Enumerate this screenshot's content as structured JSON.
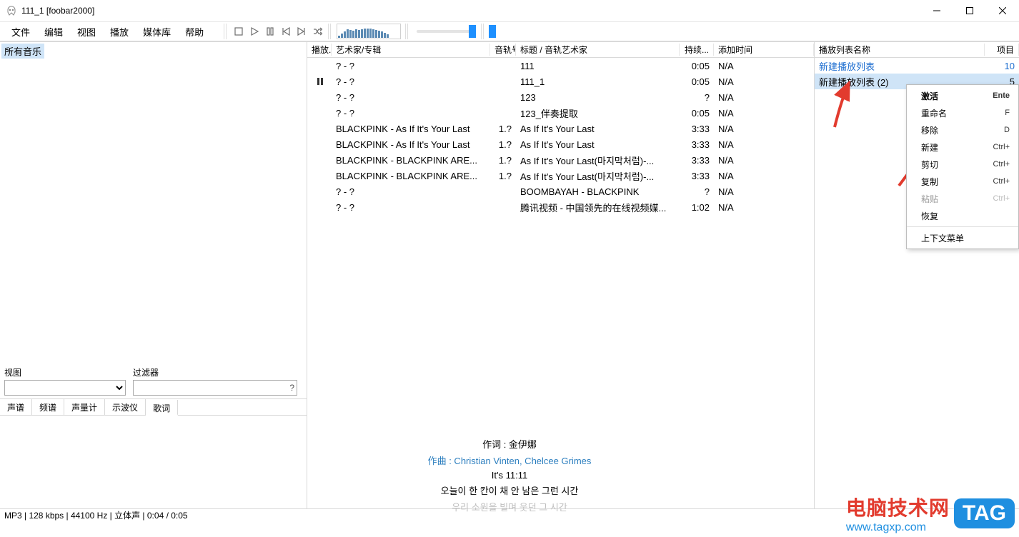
{
  "window": {
    "title": "111_1  [foobar2000]"
  },
  "menu": {
    "items": [
      "文件",
      "编辑",
      "视图",
      "播放",
      "媒体库",
      "帮助"
    ]
  },
  "left": {
    "all_music": "所有音乐",
    "view_label": "视图",
    "filter_label": "过滤器",
    "filter_q": "?"
  },
  "tabs": {
    "items": [
      "声谱",
      "频谱",
      "声量计",
      "示波仪",
      "歌词"
    ],
    "active": 4
  },
  "lyrics": {
    "l1": "作词 : 金伊娜",
    "l2": "作曲 : Christian Vinten, Chelcee Grimes",
    "l3": "It's 11:11",
    "l4": "오늘이 한 칸이 채 안 남은 그런 시간",
    "l5": "우리 소원을 빌며 웃던 그 시간"
  },
  "mid_headers": {
    "play": "播放...",
    "artist": "艺术家/专辑",
    "track": "音轨号",
    "title": "标题 / 音轨艺术家",
    "dur": "持续...",
    "added": "添加时间"
  },
  "tracks": [
    {
      "artist": "? - ?",
      "trk": "",
      "title": "111",
      "dur": "0:05",
      "added": "N/A",
      "playing": false
    },
    {
      "artist": "? - ?",
      "trk": "",
      "title": "111_1",
      "dur": "0:05",
      "added": "N/A",
      "playing": true
    },
    {
      "artist": "? - ?",
      "trk": "",
      "title": "123",
      "dur": "?",
      "added": "N/A",
      "playing": false
    },
    {
      "artist": "? - ?",
      "trk": "",
      "title": "123_伴奏提取",
      "dur": "0:05",
      "added": "N/A",
      "playing": false
    },
    {
      "artist": "BLACKPINK - As If It's Your Last",
      "trk": "1.?",
      "title": "As If It's Your Last",
      "dur": "3:33",
      "added": "N/A",
      "playing": false
    },
    {
      "artist": "BLACKPINK - As If It's Your Last",
      "trk": "1.?",
      "title": "As If It's Your Last",
      "dur": "3:33",
      "added": "N/A",
      "playing": false
    },
    {
      "artist": "BLACKPINK - BLACKPINK ARE...",
      "trk": "1.?",
      "title": "As If It's Your Last(마지막처럼)-...",
      "dur": "3:33",
      "added": "N/A",
      "playing": false
    },
    {
      "artist": "BLACKPINK - BLACKPINK ARE...",
      "trk": "1.?",
      "title": "As If It's Your Last(마지막처럼)-...",
      "dur": "3:33",
      "added": "N/A",
      "playing": false
    },
    {
      "artist": "? - ?",
      "trk": "",
      "title": "BOOMBAYAH - BLACKPINK",
      "dur": "?",
      "added": "N/A",
      "playing": false
    },
    {
      "artist": "? - ?",
      "trk": "",
      "title": "腾讯视频 - 中国领先的在线视频媒...",
      "dur": "1:02",
      "added": "N/A",
      "playing": false
    }
  ],
  "pl_headers": {
    "name": "播放列表名称",
    "count": "项目"
  },
  "playlists": [
    {
      "name": "新建播放列表",
      "count": "10",
      "active": true,
      "sel": false
    },
    {
      "name": "新建播放列表 (2)",
      "count": "5",
      "active": false,
      "sel": true
    }
  ],
  "ctx": {
    "items": [
      {
        "label": "激活",
        "shortcut": "Ente",
        "bold": true
      },
      {
        "label": "重命名",
        "shortcut": "F"
      },
      {
        "label": "移除",
        "shortcut": "D"
      },
      {
        "label": "新建",
        "shortcut": "Ctrl+"
      },
      {
        "label": "剪切",
        "shortcut": "Ctrl+"
      },
      {
        "label": "复制",
        "shortcut": "Ctrl+"
      },
      {
        "label": "粘贴",
        "shortcut": "Ctrl+",
        "disabled": true
      },
      {
        "label": "恢复",
        "shortcut": ""
      },
      {
        "sep": true
      },
      {
        "label": "上下文菜单",
        "shortcut": ""
      }
    ]
  },
  "status": "MP3 | 128 kbps | 44100 Hz | 立体声 | 0:04 / 0:05",
  "watermark": {
    "cn": "电脑技术网",
    "url": "www.tagxp.com",
    "tag": "TAG"
  },
  "visualizer_bars": [
    3,
    6,
    9,
    12,
    11,
    10,
    12,
    11,
    12,
    13,
    13,
    13,
    12,
    11,
    10,
    9,
    7,
    5
  ],
  "volume_pos": 0.97,
  "seek_pos": 0.97
}
